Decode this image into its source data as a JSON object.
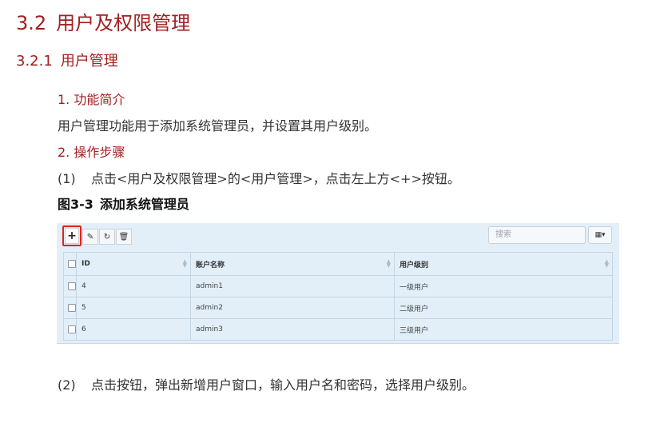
{
  "section": {
    "number": "3.2",
    "title": "用户及权限管理"
  },
  "subsection": {
    "number": "3.2.1",
    "title": "用户管理"
  },
  "intro": {
    "heading": "1. 功能简介",
    "text": "用户管理功能用于添加系统管理员，并设置其用户级别。"
  },
  "steps": {
    "heading": "2. 操作步骤",
    "step1": {
      "index": "(1)",
      "text": "点击<用户及权限管理>的<用户管理>，点击左上方<+>按钮。"
    },
    "step2": {
      "index": "(2)",
      "text": "点击按钮，弹出新增用户窗口，输入用户名和密码，选择用户级别。"
    }
  },
  "figure": {
    "number": "图3-3",
    "caption": "添加系统管理员",
    "toolbar": {
      "add_label": "+",
      "edit_label": "✎",
      "refresh_label": "↻",
      "delete_label": "🗑",
      "search_placeholder": "搜索",
      "columns_label": "▦▾"
    },
    "table": {
      "headers": [
        "ID",
        "账户名称",
        "用户级别"
      ],
      "rows": [
        [
          "4",
          "admin1",
          "一级用户"
        ],
        [
          "5",
          "admin2",
          "二级用户"
        ],
        [
          "6",
          "admin3",
          "三级用户"
        ]
      ]
    },
    "highlight_color": "#e2231a",
    "panel_color": "#e2eff9"
  }
}
